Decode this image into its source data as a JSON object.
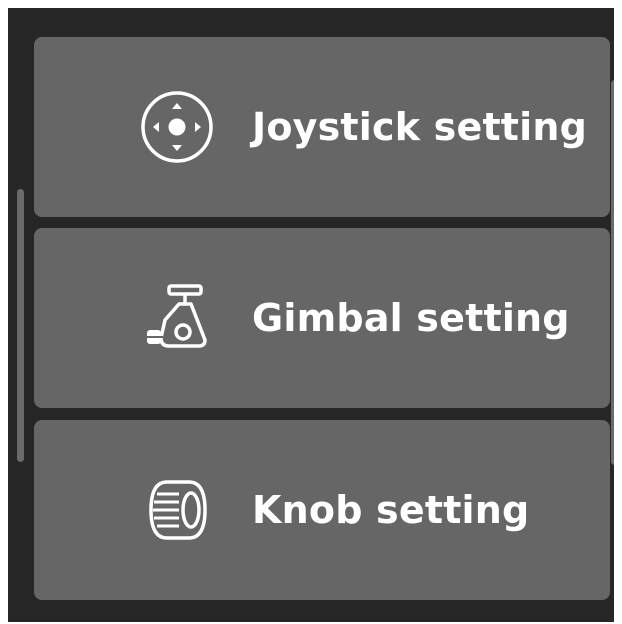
{
  "menu": {
    "items": [
      {
        "label": "Joystick setting",
        "icon": "joystick-icon"
      },
      {
        "label": "Gimbal setting",
        "icon": "gimbal-icon"
      },
      {
        "label": "Knob setting",
        "icon": "knob-icon"
      }
    ]
  },
  "colors": {
    "screen_background": "#262626",
    "item_background": "#666666",
    "text": "#ffffff",
    "scrollbar": "#6b6b6b"
  }
}
